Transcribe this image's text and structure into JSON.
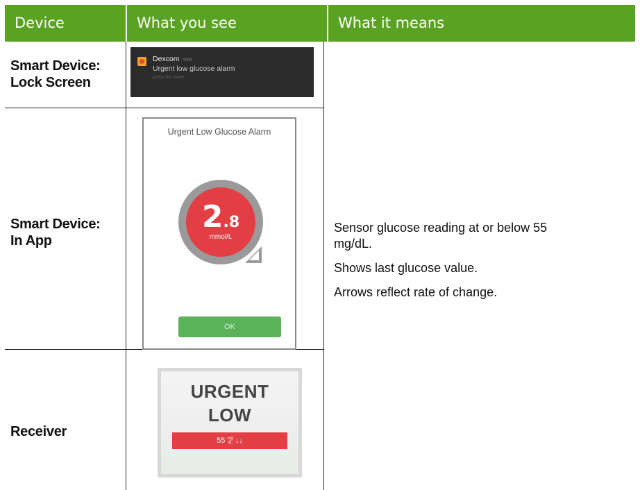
{
  "header": {
    "col_device": "Device",
    "col_see": "What you see",
    "col_means": "What it means"
  },
  "rows": [
    {
      "device_line1": "Smart Device:",
      "device_line2": "Lock Screen"
    },
    {
      "device_line1": "Smart Device:",
      "device_line2": "In App"
    },
    {
      "device_line1": "Receiver"
    }
  ],
  "lock_screen": {
    "app_name": "Dexcom",
    "time": "now",
    "message": "Urgent low glucose alarm",
    "sub": "press for more"
  },
  "app_screen": {
    "title": "Urgent Low Glucose Alarm",
    "value_int": "2",
    "value_dec": ".8",
    "unit": "mmol/L",
    "ok_label": "OK"
  },
  "receiver_screen": {
    "line1": "URGENT",
    "line2": "LOW",
    "value": "55",
    "unit_top": "mg",
    "unit_bottom": "dL",
    "arrows": "↓↓"
  },
  "meaning": {
    "p1": "Sensor glucose reading at or below 55 mg/dL.",
    "p2": "Shows last glucose value.",
    "p3": "Arrows reflect rate of change."
  },
  "colors": {
    "header_green": "#5aa221",
    "alarm_red": "#e23e44",
    "ok_green": "#5bb25b"
  }
}
